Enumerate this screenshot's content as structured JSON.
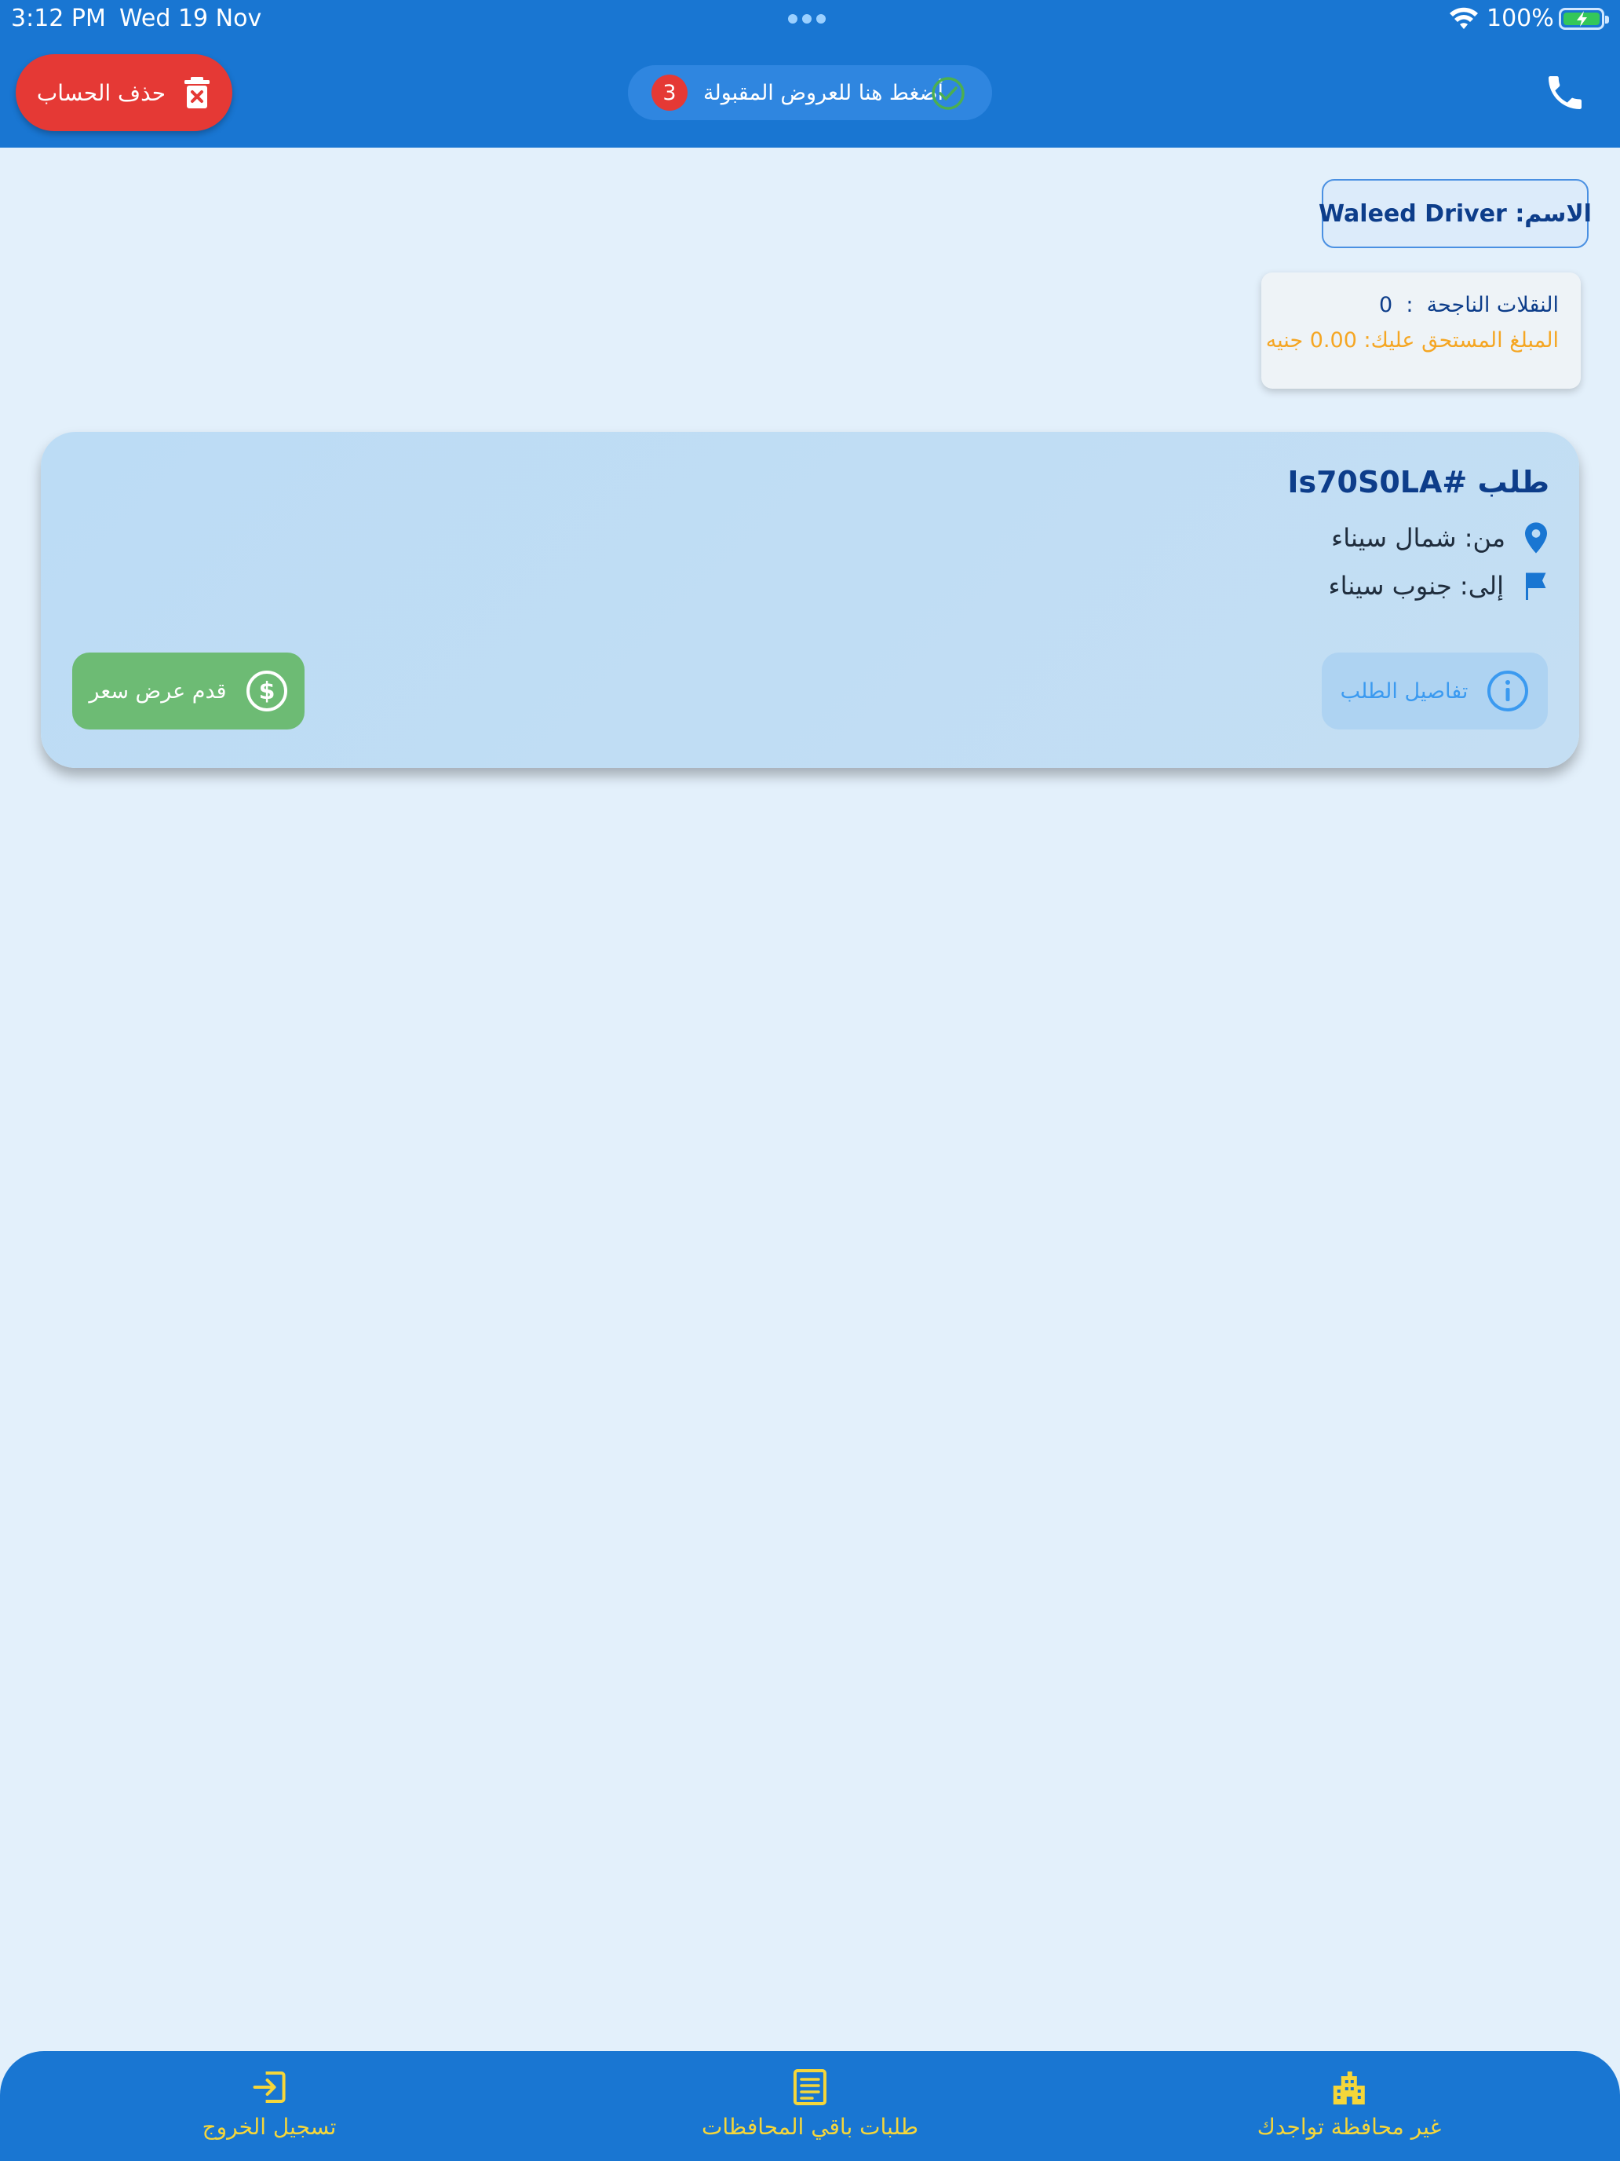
{
  "status_bar": {
    "time": "3:12 PM",
    "date": "Wed 19 Nov",
    "battery": "100%"
  },
  "app_bar": {
    "delete_account_label": "حذف الحساب",
    "accepted_offers_label": "أضغط هنا للعروض المقبولة",
    "accepted_offers_count": "3",
    "icons": [
      "trash-icon",
      "check-circle-icon",
      "phone-icon"
    ]
  },
  "profile": {
    "name_label": "الاسم:",
    "name_value": "Waleed Driver",
    "successful_transfers_label": "النقلات الناجحة",
    "successful_transfers_sep": ":",
    "successful_transfers_value": "0",
    "amount_due_label": "المبلغ المستحق عليك:",
    "amount_due_value": "0.00",
    "amount_due_currency": "جنيه"
  },
  "order": {
    "title_prefix": "طلب",
    "order_id": "#Is70S0LA",
    "from_label": "من:",
    "from_value": "شمال سيناء",
    "to_label": "إلى:",
    "to_value": "جنوب سيناء",
    "details_label": "تفاصيل الطلب",
    "offer_label": "قدم عرض سعر",
    "icons": [
      "location-pin-icon",
      "flag-icon",
      "info-icon",
      "dollar-circle-icon"
    ]
  },
  "bottom_nav": {
    "items": [
      {
        "label": "غير محافظة تواجدك",
        "icon": "buildings-icon"
      },
      {
        "label": "طلبات باقي المحافظات",
        "icon": "list-icon"
      },
      {
        "label": "تسجيل الخروج",
        "icon": "logout-icon"
      }
    ]
  },
  "colors": {
    "primary": "#1976d2",
    "background": "#e3f0fb",
    "danger": "#e53935",
    "success": "#6dbb74",
    "accent_yellow": "#f5d63a",
    "warning_orange": "#f5a623"
  }
}
